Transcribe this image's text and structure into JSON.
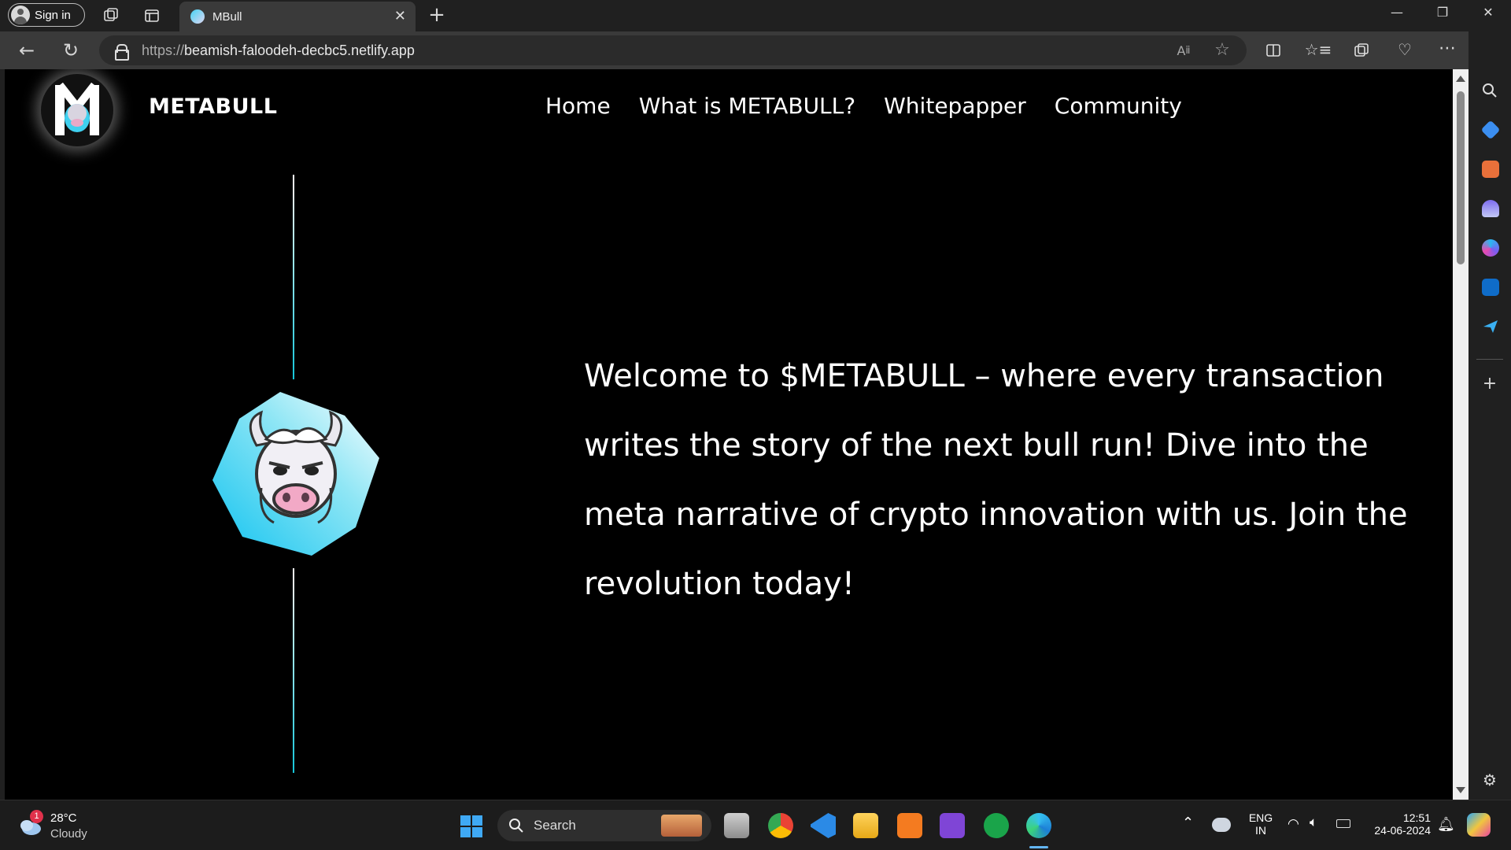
{
  "browser": {
    "signin_label": "Sign in",
    "tab_title": "MBull",
    "url_protocol": "https://",
    "url_host": "beamish-faloodeh-decbc5.netlify.app"
  },
  "site": {
    "brand": "METABULL",
    "nav": [
      "Home",
      "What is METABULL?",
      "Whitepapper",
      "Community"
    ],
    "hero_lines": [
      "Welcome to $METABULL – where every transaction",
      "writes the story of the next bull run! Dive into the",
      "meta narrative of crypto innovation with us. Join the",
      "revolution today!"
    ],
    "accent_color": "#15c6d9"
  },
  "taskbar": {
    "weather_temp": "28°C",
    "weather_desc": "Cloudy",
    "weather_badge": "1",
    "search_label": "Search",
    "lang_line1": "ENG",
    "lang_line2": "IN",
    "time": "12:51",
    "date": "24-06-2024"
  }
}
